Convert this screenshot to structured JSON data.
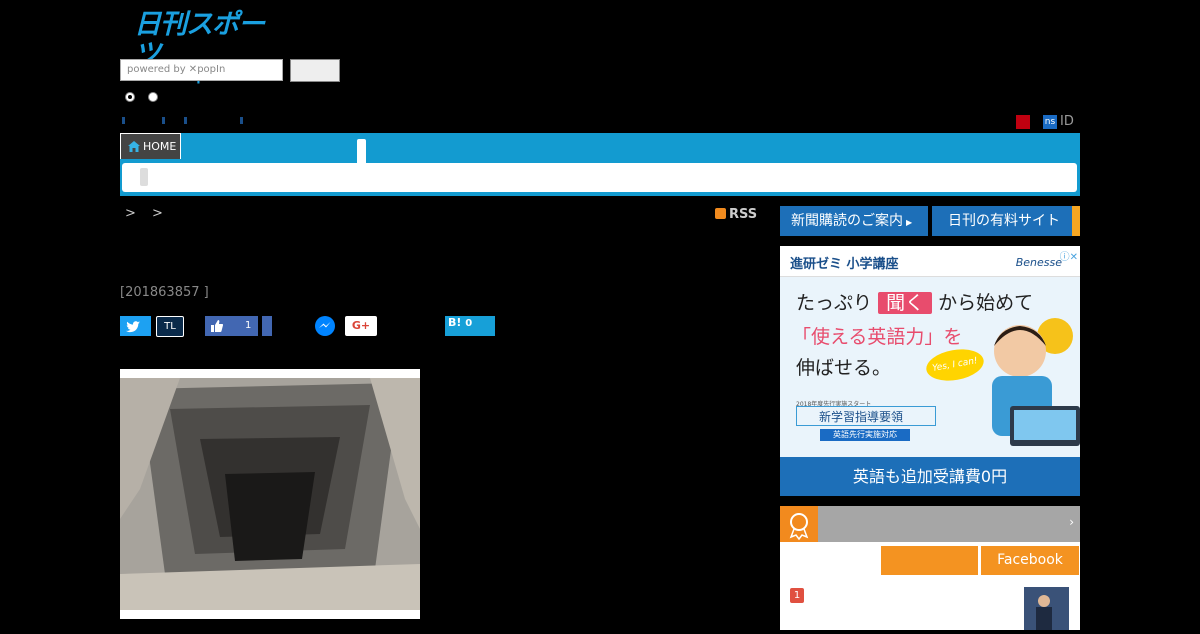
{
  "logo": {
    "title": "日刊スポーツ",
    "domain": "nikkansports.com"
  },
  "search": {
    "placeholder": "powered by ✕popIn"
  },
  "account": {
    "ns_badge": "ns",
    "id_label": "ID"
  },
  "nav": {
    "home_label": "HOME"
  },
  "breadcrumb": {
    "separators": "> >"
  },
  "rss": {
    "label": "RSS"
  },
  "article": {
    "date": "[201863857 ]"
  },
  "social": {
    "tl_label": "TL",
    "fb_like_count": "1",
    "gplus_label": "G+",
    "hatena_label": "B!",
    "hatena_count": "0"
  },
  "sidebar": {
    "subscribe_label": "新聞購読のご案内",
    "paid_site_label": "日刊の有料サイト",
    "ranking_tab_facebook": "Facebook",
    "rank_number": "1"
  },
  "ad": {
    "header": "進研ゼミ 小学講座",
    "brand": "Benesse",
    "line1_a": "たっぷり",
    "line1_b": "聞く",
    "line1_c": "から始めて",
    "line2": "「使える英語力」を",
    "line3": "伸ばせる。",
    "bubble": "Yes, I can!",
    "note": "2018年度先行実施スタート",
    "new_curriculum": "新学習指導要領",
    "english_first": "英語先行実施対応",
    "footer": "英語も追加受講費0円"
  },
  "colors": {
    "nav_blue": "#139bd0",
    "accent_orange": "#f49321",
    "button_blue": "#1d6fb8"
  }
}
